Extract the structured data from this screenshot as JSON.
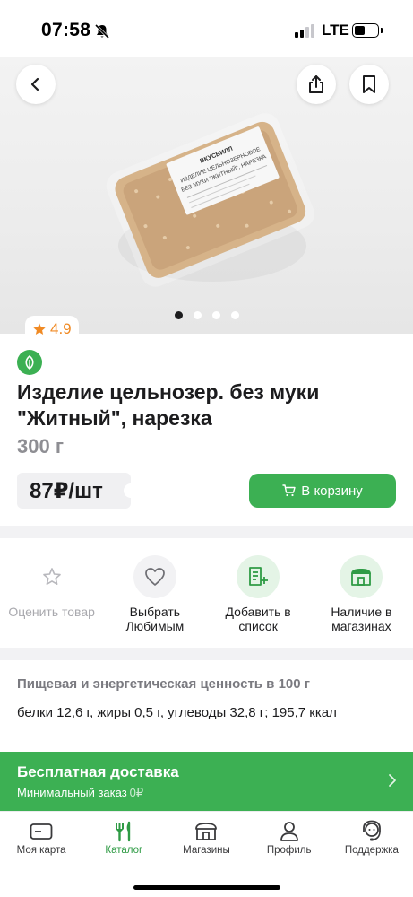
{
  "status_bar": {
    "time": "07:58",
    "network": "LTE",
    "battery_level": 0.45
  },
  "product": {
    "rating": "4.9",
    "image_count": 4,
    "active_image_index": 0,
    "title": "Изделие цельнозер. без муки \"Житный\", нарезка",
    "weight": "300 г",
    "price": "87₽/шт",
    "cart_label": "В корзину",
    "package_label_lines": [
      "ВКУСВИЛЛ",
      "ИЗДЕЛИЕ ЦЕЛЬНОЗЕРНОВОЕ",
      "БЕЗ МУКИ \"ЖИТНЫЙ\", НАРЕЗКА"
    ]
  },
  "actions": [
    {
      "label": "Оценить товар",
      "icon": "star-outline-icon",
      "enabled": false
    },
    {
      "label": "Выбрать Любимым",
      "icon": "heart-outline-icon",
      "enabled": true
    },
    {
      "label": "Добавить в список",
      "icon": "list-add-icon",
      "enabled": true
    },
    {
      "label": "Наличие в магазинах",
      "icon": "store-icon",
      "enabled": true
    }
  ],
  "nutrition": {
    "title": "Пищевая и энергетическая ценность в 100 г",
    "value": "белки 12,6 г, жиры 0,5 г, углеводы 32,8 г; 195,7 ккал"
  },
  "delivery": {
    "title": "Бесплатная доставка",
    "min_order_label": "Минимальный заказ",
    "min_order_value": "0₽"
  },
  "tabs": [
    {
      "label": "Моя карта",
      "icon": "card-icon",
      "active": false
    },
    {
      "label": "Каталог",
      "icon": "cutlery-icon",
      "active": true
    },
    {
      "label": "Магазины",
      "icon": "store-icon",
      "active": false
    },
    {
      "label": "Профиль",
      "icon": "profile-icon",
      "active": false
    },
    {
      "label": "Поддержка",
      "icon": "support-icon",
      "active": false
    }
  ],
  "colors": {
    "accent_green": "#3cb053",
    "rating_orange": "#f08a24",
    "muted_text": "#8e8e93"
  }
}
